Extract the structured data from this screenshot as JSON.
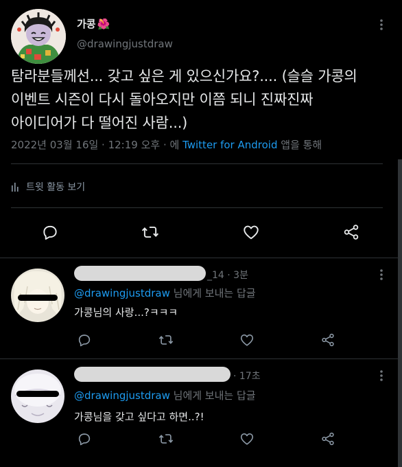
{
  "main_tweet": {
    "author_name": "가콩",
    "author_emoji": "🌺",
    "author_handle": "@drawingjustdraw",
    "text": "탐라분들께선... 갖고 싶은 게 있으신가요?.... (슬슬 가콩의\n이벤트 시즌이 다시 돌아오지만 이쯤 되니 진짜진짜\n아이디어가 다 떨어진 사람...)",
    "meta_prefix": "2022년 03월 16일 · 12:19 오후 · 에 ",
    "meta_source": "Twitter for Android",
    "meta_suffix": " 앱을 통해",
    "activity_label": "트윗 활동 보기"
  },
  "replies": [
    {
      "handle_suffix": "_14",
      "time": "· 3분",
      "reply_to_mention": "@drawingjustdraw",
      "reply_to_suffix": " 님에게 보내는 답글",
      "text": "가콩님의 사랑...?ㅋㅋㅋ"
    },
    {
      "handle_suffix": "",
      "time": "· 17초",
      "reply_to_mention": "@drawingjustdraw",
      "reply_to_suffix": " 님에게 보내는 답글",
      "text": "가콩님을 갖고 싶다고 하면..?!"
    }
  ],
  "icons": {
    "more": "more-vertical-icon",
    "reply": "comment-icon",
    "retweet": "retweet-icon",
    "like": "heart-icon",
    "share": "share-icon",
    "activity": "bar-chart-icon"
  },
  "colors": {
    "background": "#000000",
    "text_primary": "#e7e9ea",
    "text_secondary": "#71767b",
    "link": "#1d9bf0",
    "divider": "#2f3336"
  }
}
